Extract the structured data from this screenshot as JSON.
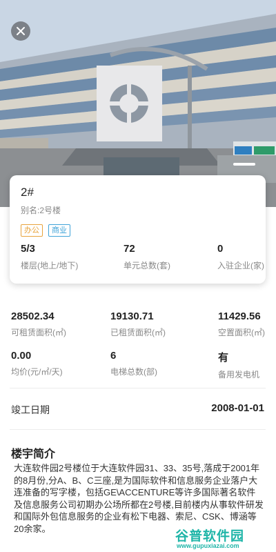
{
  "header": {
    "close_icon": "close-icon",
    "photo_alt": "building-photo"
  },
  "building": {
    "name": "2#",
    "alias": "别名:2号楼",
    "tags": [
      {
        "label": "办公",
        "color": "#e8a33c"
      },
      {
        "label": "商业",
        "color": "#3fa3d8"
      }
    ],
    "card_stats": [
      {
        "value": "5/3",
        "label": "楼层(地上/地下)"
      },
      {
        "value": "72",
        "label": "单元总数(套)"
      },
      {
        "value": "0",
        "label": "入驻企业(家)"
      }
    ]
  },
  "metrics": [
    {
      "value": "28502.34",
      "label": "可租赁面积(㎡)"
    },
    {
      "value": "19130.71",
      "label": "已租赁面积(㎡)"
    },
    {
      "value": "11429.56",
      "label": "空置面积(㎡)"
    },
    {
      "value": "0.00",
      "label": "均价(元/㎡/天)"
    },
    {
      "value": "6",
      "label": "电梯总数(部)"
    },
    {
      "value": "有",
      "label": "备用发电机"
    }
  ],
  "completion": {
    "label": "竣工日期",
    "value": "2008-01-01"
  },
  "intro": {
    "title": "楼宇简介",
    "text": "大连软件园2号楼位于大连软件园31、33、35号,落成于2001年的8月份,分A、B、C三座,是为国际软件和信息服务企业落户大连准备的写字楼，包括GE\\ACCENTURE等许多国际著名软件及信息服务公司初期办公场所都在2号楼,目前楼内从事软件研发和国际外包信息服务的企业有松下电器、索尼、CSK、博涵等20余家。"
  },
  "watermark": {
    "logo": "谷普软件园",
    "url": "www.gupuxiazai.com"
  },
  "colors": {
    "tag_office": "#e8a33c",
    "tag_commerce": "#3fa3d8",
    "watermark": "#1fb5a8"
  }
}
